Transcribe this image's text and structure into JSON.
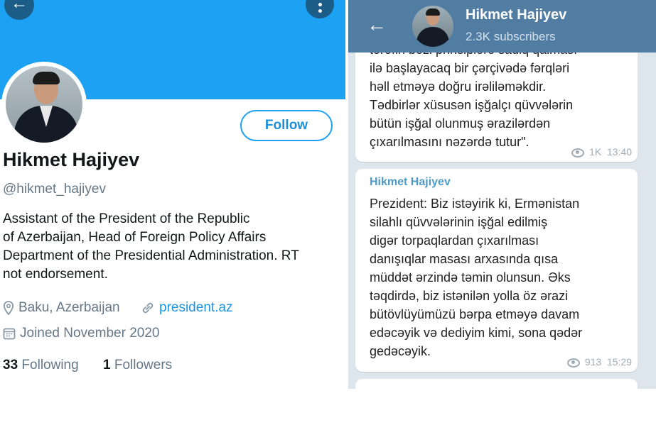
{
  "twitter": {
    "name": "Hikmet Hajiyev",
    "handle": "@hikmet_hajiyev",
    "follow_label": "Follow",
    "bio_lines": [
      "Assistant of the President of the Republic",
      "of Azerbaijan, Head of Foreign Policy Affairs",
      "Department of the Presidential Administration.  RT",
      "not endorsement."
    ],
    "location": "Baku, Azerbaijan",
    "website": "president.az",
    "joined": "Joined November 2020",
    "following_count": "33",
    "following_label": "Following",
    "followers_count": "1",
    "followers_label": "Followers",
    "accent_color": "#1da1f2",
    "icons": [
      "back-arrow-icon",
      "more-vertical-icon",
      "location-pin-icon",
      "link-icon",
      "calendar-icon"
    ]
  },
  "telegram": {
    "channel_name": "Hikmet Hajiyev",
    "subscribers": "2.3K subscribers",
    "header_color": "#527da3",
    "messages": [
      {
        "lines": [
          "tərəfin bəzi prinsiplərə sadiq qalması",
          "ilə başlayacaq bir çərçivədə fərqləri",
          "həll etməyə doğru irəliləməkdir.",
          "Tədbirlər xüsusən işğalçı qüvvələrin",
          "bütün işğal olunmuş ərazilərdən",
          "çıxarılmasını nəzərdə tutur\"."
        ],
        "views": "1K",
        "time": "13:40"
      },
      {
        "author": "Hikmet Hajiyev",
        "lines": [
          "Prezident: Biz istəyirik ki, Ermənistan",
          "silahlı qüvvələrinin işğal edilmiş",
          "digər torpaqlardan çıxarılması",
          "danışıqlar masası arxasında qısa",
          "müddət ərzində təmin olunsun. Əks",
          "təqdirdə, biz istənilən yolla öz ərazi",
          "bütövlüyümüzü bərpa etməyə davam",
          "edəcəyik və dediyim kimi, sona qədər",
          "gedəcəyik."
        ],
        "views": "913",
        "time": "15:29"
      }
    ],
    "icons": [
      "back-arrow-icon",
      "eye-icon"
    ]
  }
}
